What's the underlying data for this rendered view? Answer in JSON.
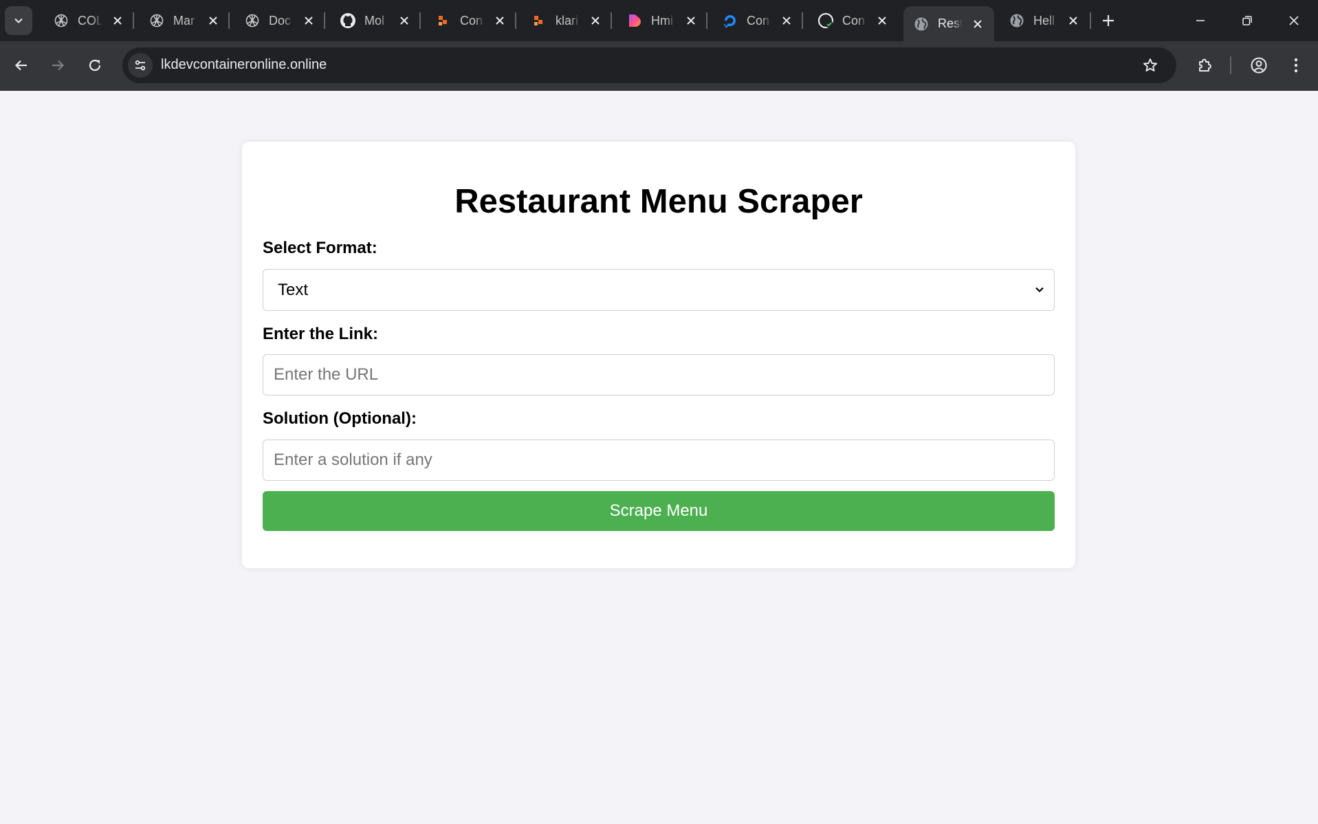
{
  "browser": {
    "tabs": [
      {
        "title": "COL",
        "icon": "openai-icon",
        "active": false
      },
      {
        "title": "Mar",
        "icon": "openai-icon",
        "active": false
      },
      {
        "title": "Doc",
        "icon": "openai-icon",
        "active": false
      },
      {
        "title": "Mol",
        "icon": "github-icon",
        "active": false
      },
      {
        "title": "Con",
        "icon": "orange-blocks-icon",
        "active": false
      },
      {
        "title": "klari",
        "icon": "orange-blocks-icon",
        "active": false
      },
      {
        "title": "Hmi",
        "icon": "heart-gradient-icon",
        "active": false
      },
      {
        "title": "Con",
        "icon": "digitalocean-icon",
        "active": false
      },
      {
        "title": "Con",
        "icon": "github-check-icon",
        "active": false
      },
      {
        "title": "Rest",
        "icon": "globe-icon",
        "active": true
      },
      {
        "title": "Hell",
        "icon": "globe-icon",
        "active": false
      }
    ],
    "url": "lkdevcontaineronline.online",
    "colors": {
      "tabstrip": "#202124",
      "toolbar": "#35363a",
      "omnibox": "#202124"
    }
  },
  "page": {
    "title": "Restaurant Menu Scraper",
    "format_label": "Select Format:",
    "format_selected": "Text",
    "link_label": "Enter the Link:",
    "link_placeholder": "Enter the URL",
    "solution_label": "Solution (Optional):",
    "solution_placeholder": "Enter a solution if any",
    "submit_label": "Scrape Menu",
    "colors": {
      "background": "#f4f4f8",
      "card": "#ffffff",
      "button": "#4caf50",
      "button_text": "#ffffff"
    }
  }
}
